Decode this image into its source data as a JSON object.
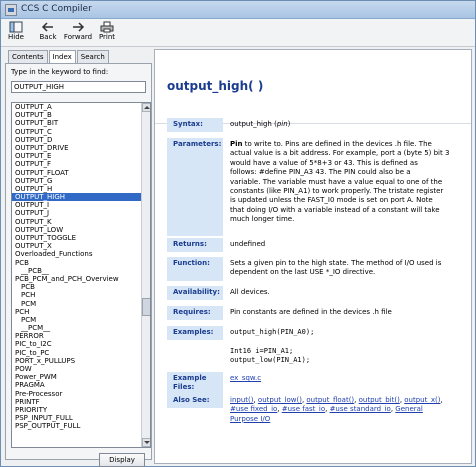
{
  "window": {
    "title": "CCS C Compiler"
  },
  "toolbar": {
    "hide": "Hide",
    "back": "Back",
    "forward": "Forward",
    "print": "Print"
  },
  "tabs": [
    "Contents",
    "Index",
    "Search"
  ],
  "index": {
    "keyword_label": "Type in the keyword to find:",
    "keyword_value": "OUTPUT_HIGH",
    "display_button": "Display",
    "items": [
      "OUTPUT_A",
      "OUTPUT_B",
      "OUTPUT_BIT",
      "OUTPUT_C",
      "OUTPUT_D",
      "OUTPUT_DRIVE",
      "OUTPUT_E",
      "OUTPUT_F",
      "OUTPUT_FLOAT",
      "OUTPUT_G",
      "OUTPUT_H",
      "OUTPUT_HIGH",
      "OUTPUT_I",
      "OUTPUT_J",
      "OUTPUT_K",
      "OUTPUT_LOW",
      "OUTPUT_TOGGLE",
      "OUTPUT_X",
      "Overloaded_Functions",
      "PCB",
      "__PCB__",
      "PCB_PCM_and_PCH_Overview",
      "PCB",
      "PCH",
      "PCM",
      "PCH",
      "PCM",
      "__PCM__",
      "PERROR",
      "PIC_to_I2C",
      "PIC_to_PC",
      "PORT_x_PULLUPS",
      "POW",
      "Power_PWM",
      "PRAGMA",
      "Pre-Processor",
      "PRINTF",
      "PRIORITY",
      "PSP_INPUT_FULL",
      "PSP_OUTPUT_FULL"
    ]
  },
  "topic": {
    "title": "output_high( )",
    "syntax_label": "Syntax:",
    "syntax_code": "output_high (",
    "syntax_param": "pin",
    "syntax_close": ")",
    "parameters_label": "Parameters:",
    "parameters_lead": "Pin",
    "parameters_lines": [
      " to write to.  Pins are defined in the devices .h file.  The",
      "actual value is a bit address.  For example, port a (byte 5) bit 3",
      "would have a value of 5*8+3 or 43.  This is defined as",
      "follows:  #define PIN_A3 43.  The PIN could also be a",
      "variable.  The variable must have a value equal to one of the",
      "constants (like PIN_A1) to work properly.  The tristate register",
      "is updated unless the FAST_I0 mode is set on port A.  Note",
      "that doing I/O with a variable instead of a constant will take",
      "much longer time."
    ],
    "returns_label": "Returns:",
    "returns_value": "undefined",
    "function_label": "Function:",
    "function_lines": [
      "Sets a given pin to the high state.  The method of I/O used is",
      "dependent on the last USE *_IO directive."
    ],
    "availability_label": "Availability:",
    "availability_value": "All devices.",
    "requires_label": "Requires:",
    "requires_value": "Pin constants are defined in the devices .h file",
    "examples_label": "Examples:",
    "examples_lines": [
      "output_high(PIN_A0);",
      "",
      "Int16 i=PIN_A1;",
      "output_low(PIN_A1);"
    ],
    "example_files_label_1": "Example",
    "example_files_label_2": "Files:",
    "example_files_value": "ex_sqw.c",
    "also_see_label": "Also See:",
    "also_see_line1": [
      "input()",
      "output_low()",
      "output_float()",
      "output_bit()",
      "output_x()"
    ],
    "also_see_line2": [
      "#use fixed_io",
      "#use fast_io",
      "#use standard_io",
      "General"
    ],
    "also_see_line3": "Purpose I/O"
  }
}
